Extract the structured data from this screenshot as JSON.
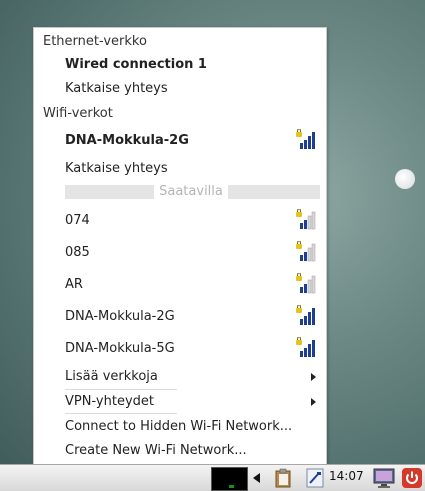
{
  "menu": {
    "ethernet_header": "Ethernet-verkko",
    "wired_connection": "Wired connection 1",
    "ethernet_disconnect": "Katkaise yhteys",
    "wifi_header": "Wifi-verkot",
    "active_wifi": "DNA-Mokkula-2G",
    "wifi_disconnect": "Katkaise yhteys",
    "available_label": "Saatavilla",
    "networks": [
      {
        "name": "074",
        "strength": "medium"
      },
      {
        "name": "085",
        "strength": "medium"
      },
      {
        "name": "AR",
        "strength": "medium"
      },
      {
        "name": "DNA-Mokkula-2G",
        "strength": "full"
      },
      {
        "name": "DNA-Mokkula-5G",
        "strength": "full"
      }
    ],
    "more_networks": "Lisää verkkoja",
    "vpn": "VPN-yhteydet",
    "connect_hidden": "Connect to Hidden Wi-Fi Network...",
    "create_new": "Create New Wi-Fi Network..."
  },
  "taskbar": {
    "clock": "14:07",
    "icons": [
      "system-monitor-icon",
      "back-arrow-icon",
      "clipboard-icon",
      "network-signal-icon",
      "display-icon",
      "power-icon"
    ]
  },
  "colors": {
    "signal_bar_dark": "#1e3f8f",
    "signal_bar_light": "#d8d8d8",
    "lock_yellow": "#e8c020",
    "power_red": "#d43a2c"
  }
}
